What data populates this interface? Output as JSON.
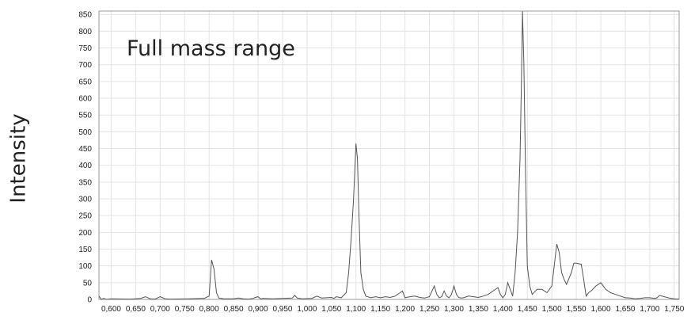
{
  "chart_data": {
    "type": "line",
    "title": "",
    "annotation": "Full mass range",
    "xlabel": "",
    "ylabel": "Intensity",
    "xlim": [
      575,
      1760
    ],
    "ylim": [
      0,
      860
    ],
    "grid": true,
    "x_ticks": [
      "0,600",
      "0,650",
      "0,700",
      "0,750",
      "0,800",
      "0,850",
      "0,900",
      "0,950",
      "1,000",
      "1,050",
      "1,100",
      "1,150",
      "1,200",
      "1,250",
      "1,300",
      "1,350",
      "1,400",
      "1,450",
      "1,500",
      "1,550",
      "1,600",
      "1,650",
      "1,700",
      "1,750"
    ],
    "y_ticks": [
      "0",
      "50",
      "100",
      "150",
      "200",
      "250",
      "300",
      "350",
      "400",
      "450",
      "500",
      "550",
      "600",
      "650",
      "700",
      "750",
      "800",
      "850"
    ],
    "series": [
      {
        "color": "#555555",
        "x": [
          575,
          580,
          585,
          590,
          600,
          640,
          660,
          670,
          680,
          690,
          700,
          710,
          720,
          760,
          790,
          800,
          805,
          810,
          815,
          820,
          830,
          850,
          860,
          870,
          880,
          890,
          895,
          900,
          905,
          910,
          930,
          970,
          975,
          980,
          990,
          1010,
          1020,
          1030,
          1050,
          1055,
          1060,
          1070,
          1080,
          1085,
          1090,
          1095,
          1100,
          1103,
          1106,
          1110,
          1115,
          1120,
          1130,
          1140,
          1150,
          1160,
          1170,
          1180,
          1190,
          1195,
          1200,
          1210,
          1220,
          1230,
          1240,
          1250,
          1260,
          1265,
          1270,
          1275,
          1280,
          1285,
          1290,
          1295,
          1300,
          1305,
          1310,
          1315,
          1320,
          1330,
          1340,
          1350,
          1360,
          1370,
          1380,
          1390,
          1395,
          1400,
          1405,
          1410,
          1415,
          1420,
          1425,
          1430,
          1435,
          1438,
          1440,
          1443,
          1446,
          1450,
          1455,
          1460,
          1470,
          1480,
          1490,
          1500,
          1510,
          1515,
          1520,
          1525,
          1530,
          1540,
          1545,
          1550,
          1560,
          1565,
          1570,
          1575,
          1580,
          1590,
          1600,
          1610,
          1620,
          1630,
          1640,
          1650,
          1660,
          1670,
          1680,
          1690,
          1700,
          1710,
          1715,
          1720,
          1730,
          1740,
          1750,
          1760
        ],
        "y": [
          10,
          0,
          3,
          0,
          2,
          1,
          3,
          8,
          2,
          1,
          8,
          2,
          1,
          2,
          3,
          10,
          118,
          90,
          20,
          4,
          2,
          2,
          4,
          2,
          1,
          3,
          6,
          8,
          2,
          3,
          2,
          4,
          12,
          4,
          2,
          3,
          10,
          4,
          6,
          3,
          8,
          5,
          20,
          80,
          180,
          300,
          465,
          420,
          250,
          80,
          30,
          10,
          5,
          8,
          5,
          8,
          6,
          10,
          20,
          25,
          5,
          8,
          10,
          6,
          4,
          8,
          40,
          15,
          5,
          8,
          25,
          10,
          5,
          15,
          40,
          15,
          6,
          4,
          5,
          10,
          8,
          6,
          10,
          15,
          25,
          35,
          15,
          5,
          15,
          50,
          30,
          10,
          80,
          200,
          420,
          650,
          860,
          700,
          400,
          100,
          40,
          15,
          30,
          30,
          20,
          40,
          165,
          140,
          80,
          60,
          45,
          80,
          108,
          108,
          105,
          60,
          10,
          20,
          25,
          40,
          50,
          30,
          20,
          15,
          10,
          5,
          4,
          2,
          3,
          5,
          5,
          3,
          5,
          12,
          8,
          4,
          2,
          1
        ]
      }
    ]
  }
}
